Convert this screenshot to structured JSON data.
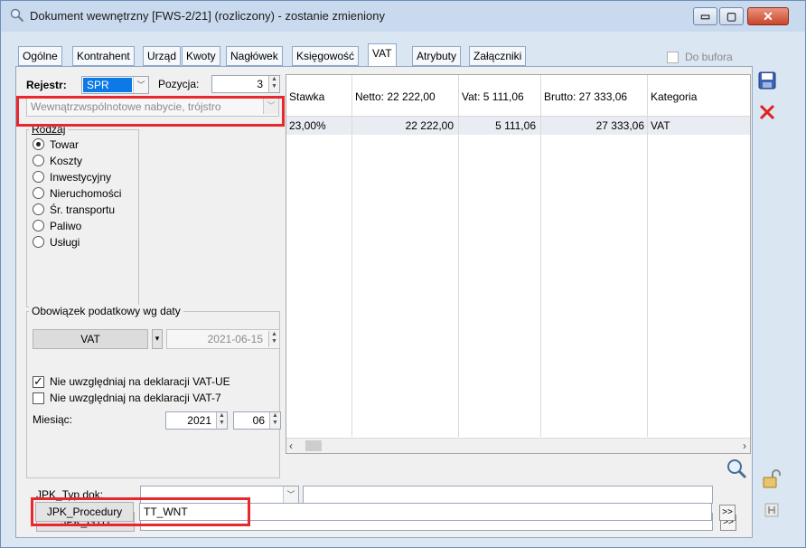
{
  "window": {
    "title": "Dokument wewnętrzny [FWS-2/21] (rozliczony) - zostanie zmieniony",
    "minimize_glyph": "▭",
    "maximize_glyph": "▢",
    "close_glyph": "✕"
  },
  "tabs": [
    {
      "label": "Ogólne"
    },
    {
      "label": "Kontrahent"
    },
    {
      "label": "Urząd"
    },
    {
      "label": "Kwoty"
    },
    {
      "label": "Nagłówek"
    },
    {
      "label": "Księgowość"
    },
    {
      "label": "VAT"
    },
    {
      "label": "Atrybuty"
    },
    {
      "label": "Załączniki"
    }
  ],
  "active_tab": "VAT",
  "do_bufora": {
    "label": "Do bufora",
    "checked": false
  },
  "rejestr": {
    "label": "Rejestr:",
    "value": "SPR"
  },
  "pozycja": {
    "label": "Pozycja:",
    "value": "3"
  },
  "transaction_type": {
    "value": "Wewnątrzwspólnotowe nabycie, trójstro"
  },
  "rodzaj": {
    "title": "Rodzaj",
    "options": [
      {
        "label": "Towar",
        "selected": true
      },
      {
        "label": "Koszty",
        "selected": false
      },
      {
        "label": "Inwestycyjny",
        "selected": false
      },
      {
        "label": "Nieruchomości",
        "selected": false
      },
      {
        "label": "Śr. transportu",
        "selected": false
      },
      {
        "label": "Paliwo",
        "selected": false
      },
      {
        "label": "Usługi",
        "selected": false
      }
    ]
  },
  "obowiazek": {
    "title": "Obowiązek podatkowy wg daty",
    "button_label": "VAT",
    "date_value": "2021-06-15"
  },
  "checkboxes": {
    "vat_ue": {
      "label": "Nie uwzględniaj na deklaracji VAT-UE",
      "checked": true
    },
    "vat_7": {
      "label": "Nie uwzględniaj na deklaracji VAT-7",
      "checked": false
    }
  },
  "miesiac": {
    "label": "Miesiąc:",
    "year": "2021",
    "month": "06"
  },
  "table": {
    "headers": [
      "Stawka",
      "Netto: 22 222,00",
      "Vat: 5 111,06",
      "Brutto: 27 333,06",
      "Kategoria"
    ],
    "rows": [
      [
        "23,00%",
        "22 222,00",
        "5 111,06",
        "27 333,06",
        "VAT"
      ]
    ]
  },
  "jpk": {
    "typ_label": "JPK_Typ dok:",
    "typ_value": "",
    "gtu_label": "JPK_GTU",
    "gtu_value": "",
    "procedury_label": "JPK_Procedury",
    "procedury_value": "TT_WNT",
    "more_label": ">>"
  },
  "icons": {
    "save": "save-icon",
    "delete": "delete-icon",
    "search": "magnifier-icon",
    "lock": "lock-icon",
    "pin": "pin-icon"
  },
  "colors": {
    "highlight_red": "#e8282e",
    "selection_blue": "#0c79e6"
  }
}
